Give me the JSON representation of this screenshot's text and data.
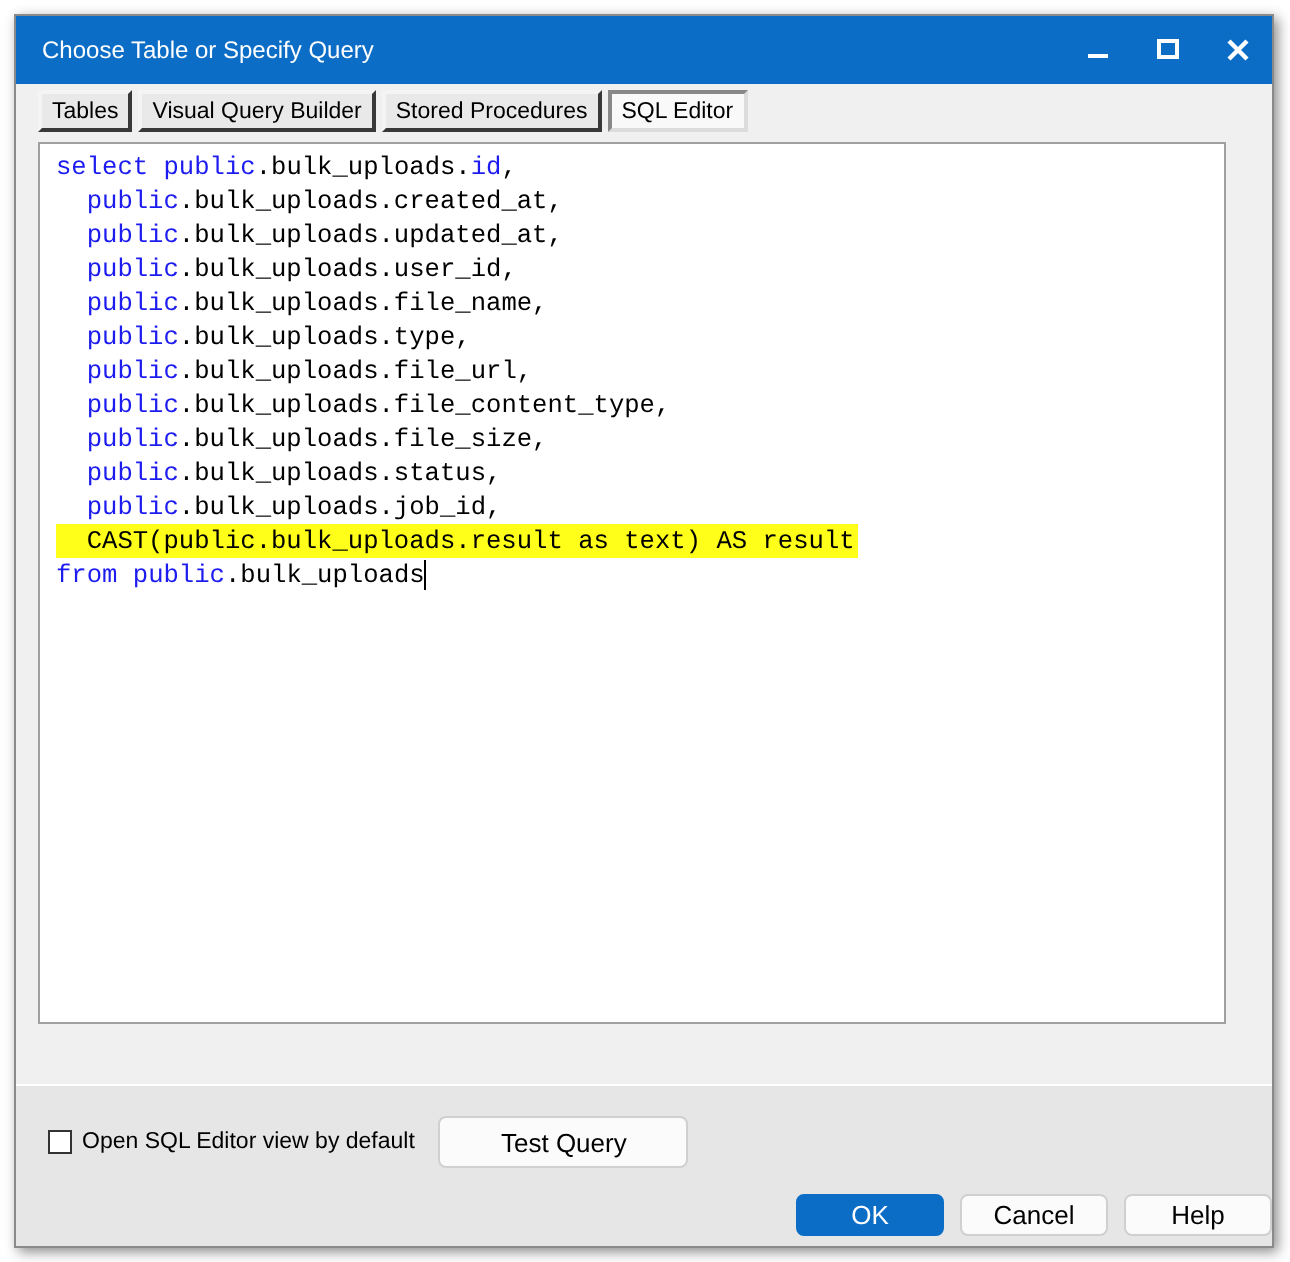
{
  "window": {
    "title": "Choose Table or Specify Query"
  },
  "tabs": [
    {
      "label": "Tables",
      "selected": false
    },
    {
      "label": "Visual Query Builder",
      "selected": false
    },
    {
      "label": "Stored Procedures",
      "selected": false
    },
    {
      "label": "SQL Editor",
      "selected": true
    }
  ],
  "editor": {
    "lines": [
      {
        "highlighted": false,
        "indented": false,
        "tokens": [
          {
            "text": "select public",
            "kind": "keyword"
          },
          {
            "text": ".bulk_uploads.",
            "kind": "plain"
          },
          {
            "text": "id",
            "kind": "keyword"
          },
          {
            "text": ",",
            "kind": "plain"
          }
        ]
      },
      {
        "highlighted": false,
        "indented": true,
        "tokens": [
          {
            "text": "public",
            "kind": "keyword"
          },
          {
            "text": ".bulk_uploads.created_at,",
            "kind": "plain"
          }
        ]
      },
      {
        "highlighted": false,
        "indented": true,
        "tokens": [
          {
            "text": "public",
            "kind": "keyword"
          },
          {
            "text": ".bulk_uploads.updated_at,",
            "kind": "plain"
          }
        ]
      },
      {
        "highlighted": false,
        "indented": true,
        "tokens": [
          {
            "text": "public",
            "kind": "keyword"
          },
          {
            "text": ".bulk_uploads.user_id,",
            "kind": "plain"
          }
        ]
      },
      {
        "highlighted": false,
        "indented": true,
        "tokens": [
          {
            "text": "public",
            "kind": "keyword"
          },
          {
            "text": ".bulk_uploads.file_name,",
            "kind": "plain"
          }
        ]
      },
      {
        "highlighted": false,
        "indented": true,
        "tokens": [
          {
            "text": "public",
            "kind": "keyword"
          },
          {
            "text": ".bulk_uploads.type,",
            "kind": "plain"
          }
        ]
      },
      {
        "highlighted": false,
        "indented": true,
        "tokens": [
          {
            "text": "public",
            "kind": "keyword"
          },
          {
            "text": ".bulk_uploads.file_url,",
            "kind": "plain"
          }
        ]
      },
      {
        "highlighted": false,
        "indented": true,
        "tokens": [
          {
            "text": "public",
            "kind": "keyword"
          },
          {
            "text": ".bulk_uploads.file_content_type,",
            "kind": "plain"
          }
        ]
      },
      {
        "highlighted": false,
        "indented": true,
        "tokens": [
          {
            "text": "public",
            "kind": "keyword"
          },
          {
            "text": ".bulk_uploads.file_size,",
            "kind": "plain"
          }
        ]
      },
      {
        "highlighted": false,
        "indented": true,
        "tokens": [
          {
            "text": "public",
            "kind": "keyword"
          },
          {
            "text": ".bulk_uploads.status,",
            "kind": "plain"
          }
        ]
      },
      {
        "highlighted": false,
        "indented": true,
        "tokens": [
          {
            "text": "public",
            "kind": "keyword"
          },
          {
            "text": ".bulk_uploads.job_id,",
            "kind": "plain"
          }
        ]
      },
      {
        "highlighted": true,
        "indented": true,
        "tokens": [
          {
            "text": "CAST(public.bulk_uploads.result as text) AS result",
            "kind": "plain"
          }
        ]
      },
      {
        "highlighted": false,
        "indented": false,
        "tokens": [
          {
            "text": "from public",
            "kind": "keyword"
          },
          {
            "text": ".bulk_uploads",
            "kind": "plain"
          }
        ]
      }
    ]
  },
  "default_view_checkbox": {
    "label": "Open SQL Editor view by default",
    "checked": false
  },
  "test_button": "Test Query",
  "buttons": [
    {
      "label": "OK",
      "kind": "primary"
    },
    {
      "label": "Cancel",
      "kind": "normal"
    },
    {
      "label": "Help",
      "kind": "normal"
    }
  ]
}
